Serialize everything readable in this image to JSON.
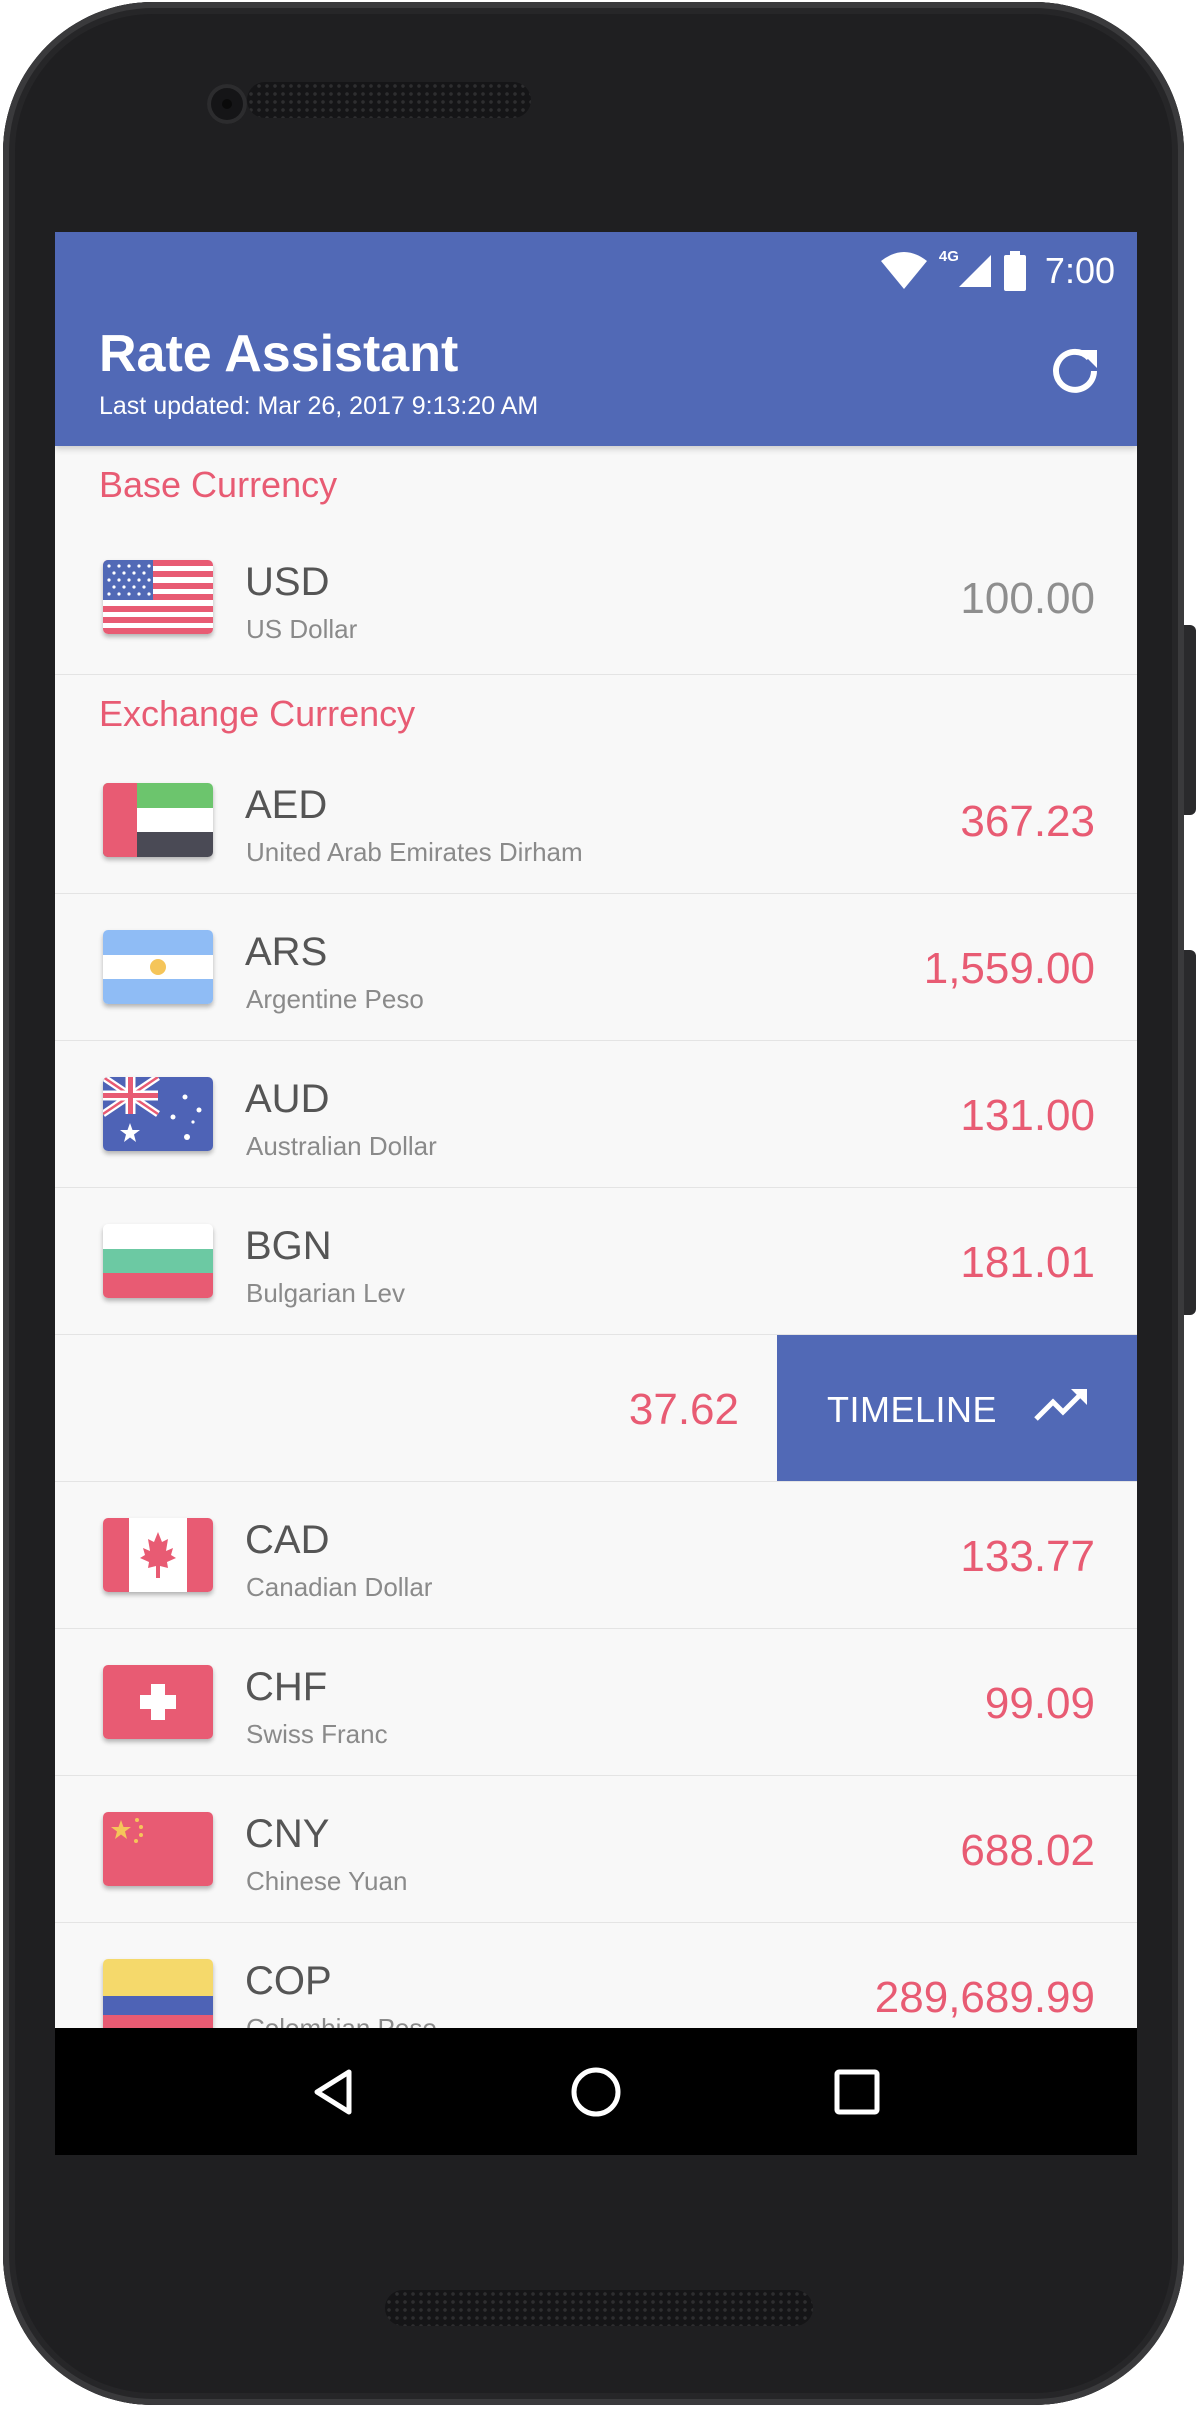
{
  "status_bar": {
    "network_label": "4G",
    "time": "7:00",
    "icons": [
      "wifi-icon",
      "cell-signal-icon",
      "battery-icon"
    ]
  },
  "app_bar": {
    "title": "Rate Assistant",
    "last_updated": "Last updated: Mar 26, 2017 9:13:20 AM",
    "action_icon": "refresh-icon"
  },
  "base_section": {
    "header": "Base Currency",
    "currency": {
      "code": "USD",
      "name": "US Dollar",
      "value": "100.00",
      "flag": "us-flag"
    }
  },
  "exchange_section": {
    "header": "Exchange Currency",
    "currencies": [
      {
        "code": "AED",
        "name": "United Arab Emirates Dirham",
        "value": "367.23",
        "flag": "ae-flag"
      },
      {
        "code": "ARS",
        "name": "Argentine Peso",
        "value": "1,559.00",
        "flag": "ar-flag"
      },
      {
        "code": "AUD",
        "name": "Australian Dollar",
        "value": "131.00",
        "flag": "au-flag"
      },
      {
        "code": "BGN",
        "name": "Bulgarian Lev",
        "value": "181.01",
        "flag": "bg-flag"
      }
    ],
    "swiped_row": {
      "value": "37.62",
      "action_label": "TIMELINE",
      "action_icon": "trending-up-icon"
    },
    "currencies_after": [
      {
        "code": "CAD",
        "name": "Canadian Dollar",
        "value": "133.77",
        "flag": "ca-flag"
      },
      {
        "code": "CHF",
        "name": "Swiss Franc",
        "value": "99.09",
        "flag": "ch-flag"
      },
      {
        "code": "CNY",
        "name": "Chinese Yuan",
        "value": "688.02",
        "flag": "cn-flag"
      },
      {
        "code": "COP",
        "name": "Colombian Peso",
        "value": "289,689.99",
        "flag": "co-flag"
      }
    ]
  },
  "nav_bar": {
    "icons": [
      "back-icon",
      "home-icon",
      "recents-icon"
    ]
  },
  "colors": {
    "primary": "#5169b6",
    "accent": "#e85b73",
    "background": "#f8f8f8"
  }
}
